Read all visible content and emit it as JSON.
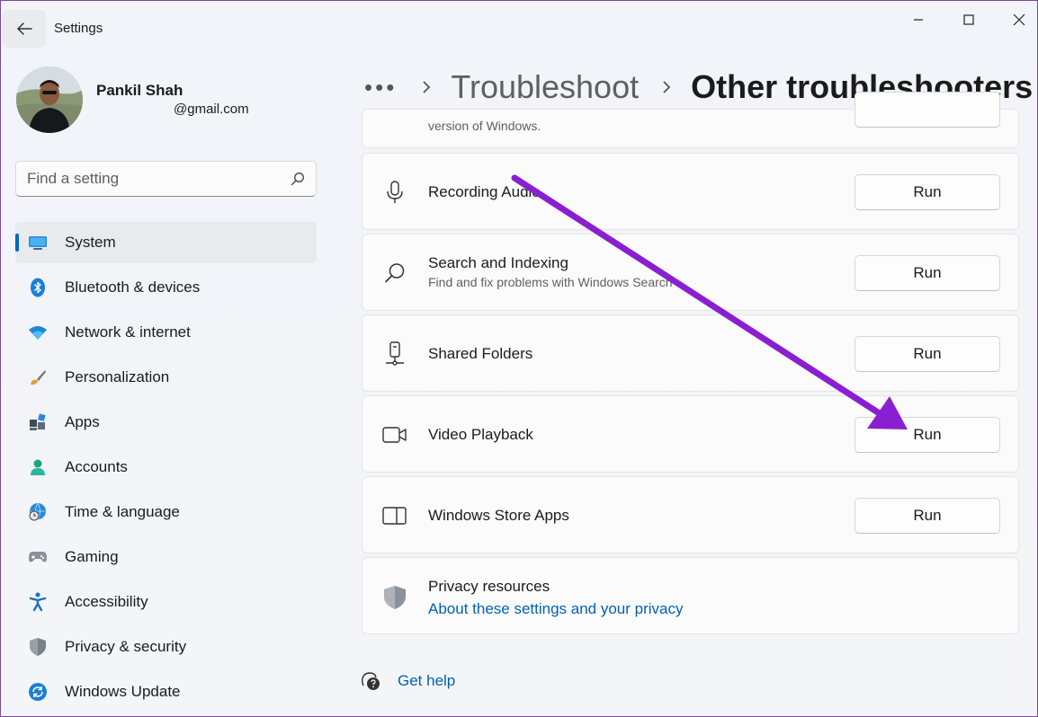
{
  "app": {
    "title": "Settings"
  },
  "user": {
    "name": "Pankil Shah",
    "email": "@gmail.com"
  },
  "search": {
    "placeholder": "Find a setting"
  },
  "nav": [
    {
      "label": "System",
      "icon": "monitor-icon",
      "active": true
    },
    {
      "label": "Bluetooth & devices",
      "icon": "bluetooth-icon"
    },
    {
      "label": "Network & internet",
      "icon": "wifi-icon"
    },
    {
      "label": "Personalization",
      "icon": "paintbrush-icon"
    },
    {
      "label": "Apps",
      "icon": "apps-icon"
    },
    {
      "label": "Accounts",
      "icon": "person-icon"
    },
    {
      "label": "Time & language",
      "icon": "globe-clock-icon"
    },
    {
      "label": "Gaming",
      "icon": "gamepad-icon"
    },
    {
      "label": "Accessibility",
      "icon": "accessibility-icon"
    },
    {
      "label": "Privacy & security",
      "icon": "shield-icon"
    },
    {
      "label": "Windows Update",
      "icon": "update-icon"
    }
  ],
  "breadcrumb": {
    "more": "•••",
    "parent": "Troubleshoot",
    "current": "Other troubleshooters"
  },
  "troubleshooters": {
    "partial_desc": "version of Windows.",
    "items": [
      {
        "title": "Recording Audio",
        "desc": "",
        "icon": "microphone-icon",
        "button": "Run"
      },
      {
        "title": "Search and Indexing",
        "desc": "Find and fix problems with Windows Search",
        "icon": "search-icon",
        "button": "Run"
      },
      {
        "title": "Shared Folders",
        "desc": "",
        "icon": "network-folder-icon",
        "button": "Run"
      },
      {
        "title": "Video Playback",
        "desc": "",
        "icon": "video-camera-icon",
        "button": "Run"
      },
      {
        "title": "Windows Store Apps",
        "desc": "",
        "icon": "store-window-icon",
        "button": "Run"
      }
    ]
  },
  "privacy": {
    "title": "Privacy resources",
    "link": "About these settings and your privacy",
    "icon": "shield-icon"
  },
  "help": {
    "label": "Get help",
    "icon": "help-icon"
  },
  "colors": {
    "accent": "#0067c0",
    "link": "#0060b8",
    "annotation_arrow": "#8a1fd1"
  }
}
